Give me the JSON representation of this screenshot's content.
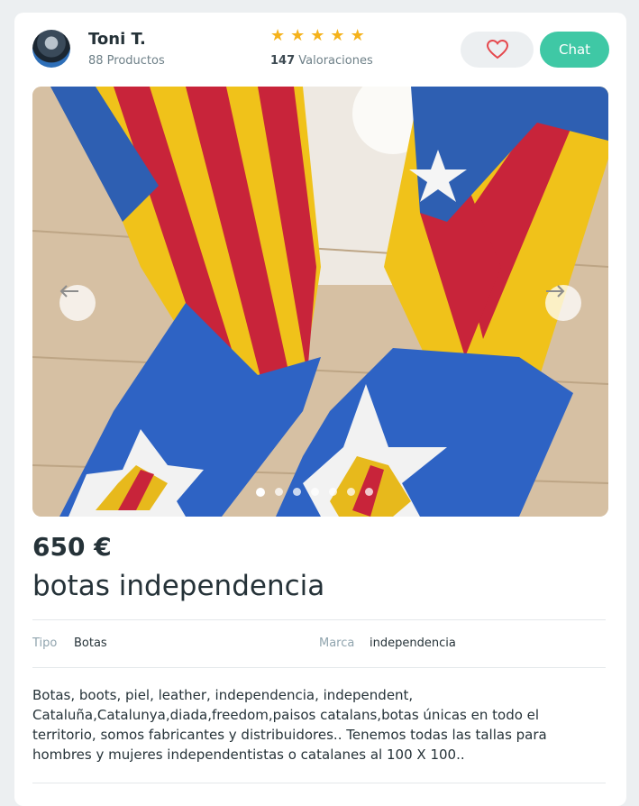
{
  "seller": {
    "name": "Toni T.",
    "products": "88 Productos",
    "rating_stars": 5,
    "ratings_count": "147",
    "ratings_label": "Valoraciones"
  },
  "actions": {
    "favorite_icon": "heart-icon",
    "chat_label": "Chat"
  },
  "gallery": {
    "image_count": 7,
    "active_index": 0,
    "prev_icon": "arrow-left-icon",
    "next_icon": "arrow-right-icon"
  },
  "item": {
    "price": "650 €",
    "title": "botas independencia",
    "attributes": {
      "tipo_label": "Tipo",
      "tipo_value": "Botas",
      "marca_label": "Marca",
      "marca_value": "independencia"
    },
    "description": "Botas, boots, piel, leather, independencia, independent, Cataluña,Catalunya,diada,freedom,paisos catalans,botas únicas en todo el territorio, somos fabricantes y distribuidores.. Tenemos todas las tallas para hombres y mujeres independentistas o catalanes al 100 X 100.."
  },
  "colors": {
    "accent": "#3fc8a5",
    "star": "#f5b21b",
    "heart": "#e5484d",
    "text": "#253238",
    "muted": "#90a4ae"
  }
}
